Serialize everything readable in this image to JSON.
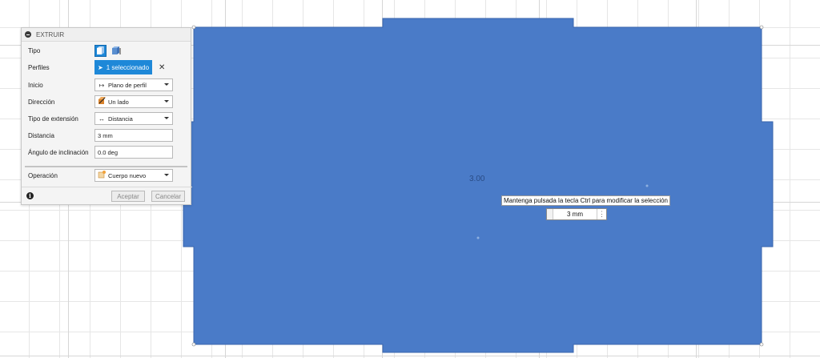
{
  "panel": {
    "title": "EXTRUIR",
    "rows": {
      "tipo": {
        "label": "Tipo"
      },
      "perfiles": {
        "label": "Perfiles",
        "value": "1 seleccionado"
      },
      "inicio": {
        "label": "Inicio",
        "value": "Plano de perfil"
      },
      "direccion": {
        "label": "Dirección",
        "value": "Un lado"
      },
      "tipo_extension": {
        "label": "Tipo de extensión",
        "value": "Distancia"
      },
      "distancia": {
        "label": "Distancia",
        "value": "3 mm"
      },
      "angulo": {
        "label": "Ángulo de inclinación",
        "value": "0.0 deg"
      },
      "operacion": {
        "label": "Operación",
        "value": "Cuerpo nuevo"
      }
    },
    "buttons": {
      "ok": "Aceptar",
      "cancel": "Cancelar"
    }
  },
  "canvas": {
    "dimension_text": "3.00",
    "hint": "Mantenga pulsada la tecla Ctrl para modificar la selección",
    "distance_input": "3 mm",
    "body_color": "#4a7bc8",
    "accent": "#1e88d8"
  }
}
